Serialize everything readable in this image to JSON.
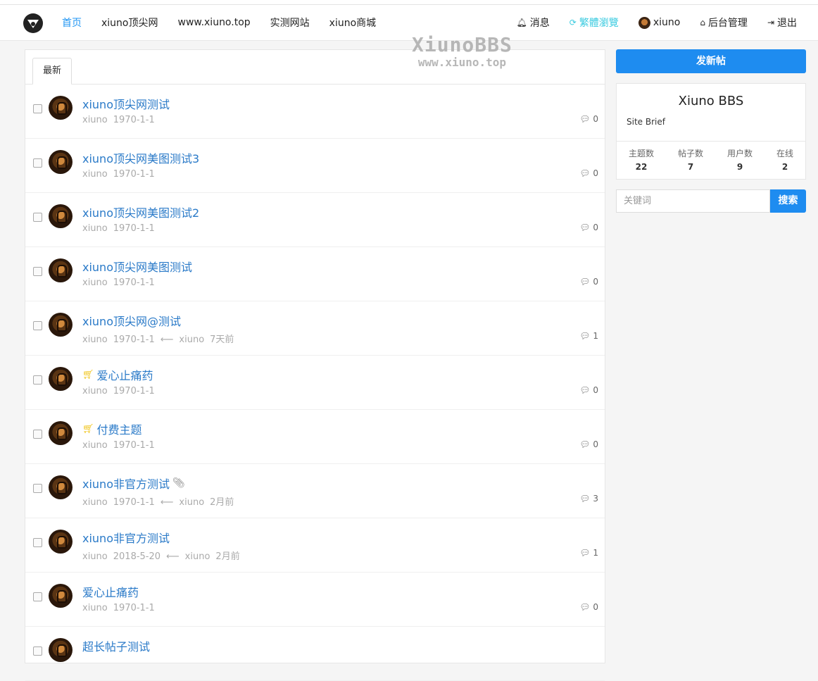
{
  "watermark": {
    "line1": "XiunoBBS",
    "line2": "www.xiuno.top"
  },
  "nav": {
    "left": [
      "首页",
      "xiuno顶尖网",
      "www.xiuno.top",
      "实测网站",
      "xiuno商城"
    ],
    "right": {
      "messages": "消息",
      "traditional": "繁體瀏覽",
      "user": "xiuno",
      "admin": "后台管理",
      "logout": "退出"
    }
  },
  "tabs": {
    "latest": "最新"
  },
  "threads": [
    {
      "title": "xiuno顶尖网测试",
      "author": "xiuno",
      "date": "1970-1-1",
      "replies": "0"
    },
    {
      "title": "xiuno顶尖网美图测试3",
      "author": "xiuno",
      "date": "1970-1-1",
      "replies": "0"
    },
    {
      "title": "xiuno顶尖网美图测试2",
      "author": "xiuno",
      "date": "1970-1-1",
      "replies": "0"
    },
    {
      "title": "xiuno顶尖网美图测试",
      "author": "xiuno",
      "date": "1970-1-1",
      "replies": "0"
    },
    {
      "title": "xiuno顶尖网@测试",
      "author": "xiuno",
      "date": "1970-1-1",
      "arrow": "⟵",
      "last_user": "xiuno",
      "last_time": "7天前",
      "replies": "1"
    },
    {
      "title": "爱心止痛药",
      "author": "xiuno",
      "date": "1970-1-1",
      "replies": "0"
    },
    {
      "title": "付费主题",
      "author": "xiuno",
      "date": "1970-1-1",
      "replies": "0"
    },
    {
      "title": "xiuno非官方测试",
      "author": "xiuno",
      "date": "1970-1-1",
      "arrow": "⟵",
      "last_user": "xiuno",
      "last_time": "2月前",
      "replies": "3"
    },
    {
      "title": "xiuno非官方测试",
      "author": "xiuno",
      "date": "2018-5-20",
      "arrow": "⟵",
      "last_user": "xiuno",
      "last_time": "2月前",
      "replies": "1"
    },
    {
      "title": "爱心止痛药",
      "author": "xiuno",
      "date": "1970-1-1",
      "replies": "0"
    },
    {
      "title": "超长帖子测试",
      "author": "",
      "date": "",
      "replies": ""
    }
  ],
  "sidebar": {
    "new_post": "发新帖",
    "site_name": "Xiuno BBS",
    "site_brief": "Site Brief",
    "stats": [
      {
        "label": "主题数",
        "value": "22"
      },
      {
        "label": "帖子数",
        "value": "7"
      },
      {
        "label": "用户数",
        "value": "9"
      },
      {
        "label": "在线",
        "value": "2"
      }
    ],
    "search_placeholder": "关键词",
    "search_button": "搜索"
  },
  "colors": {
    "primary": "#1e8cf0",
    "link": "#2a7ac8",
    "cyan": "#3ccbe0",
    "cart": "#f0c419"
  }
}
